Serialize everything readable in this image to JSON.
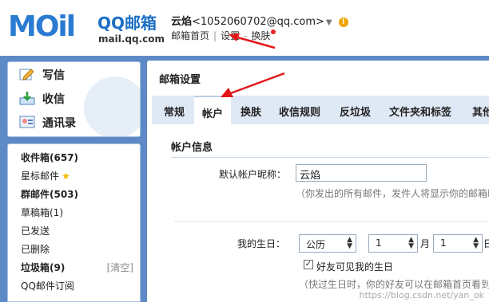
{
  "header": {
    "logo_text": "MOil",
    "logo_brand": "QQ邮箱",
    "logo_domain": "mail.qq.com",
    "user_name": "云焰",
    "user_email": "<1052060702@qq.com>",
    "links": [
      "邮箱首页",
      "设置",
      "换肤"
    ],
    "link_sep": "|",
    "link_dash": "-"
  },
  "quick_actions": [
    {
      "label": "写信",
      "icon": "pencil-icon"
    },
    {
      "label": "收信",
      "icon": "inbox-download-icon"
    },
    {
      "label": "通讯录",
      "icon": "contacts-icon"
    }
  ],
  "folders": {
    "inbox": "收件箱(657)",
    "starred": "星标邮件",
    "group": "群邮件(503)",
    "drafts": "草稿箱(1)",
    "sent": "已发送",
    "deleted": "已删除",
    "spam": "垃圾箱(9)",
    "spam_clear": "[清空]",
    "subscribe": "QQ邮件订阅"
  },
  "main": {
    "title": "邮箱设置",
    "tabs": [
      "常规",
      "帐户",
      "换肤",
      "收信规则",
      "反垃圾",
      "文件夹和标签",
      "其他"
    ],
    "active_tab": "帐户",
    "section_title": "帐户信息",
    "nickname_label": "默认帐户昵称：",
    "nickname_value": "云焰",
    "nickname_hint": "（你发出的所有邮件，发件人将显示你的邮箱昵",
    "birthday_label": "我的生日：",
    "calendar_value": "公历",
    "month_value": "1",
    "month_unit": "月",
    "day_value": "1",
    "day_unit": "日",
    "show_friends_label": "好友可见我的生日",
    "show_friends_checked": true,
    "birthday_hint": "（快过生日时，你的好友可以在邮箱首页看到"
  },
  "watermark": "https://blog.csdn.net/yan_ok"
}
